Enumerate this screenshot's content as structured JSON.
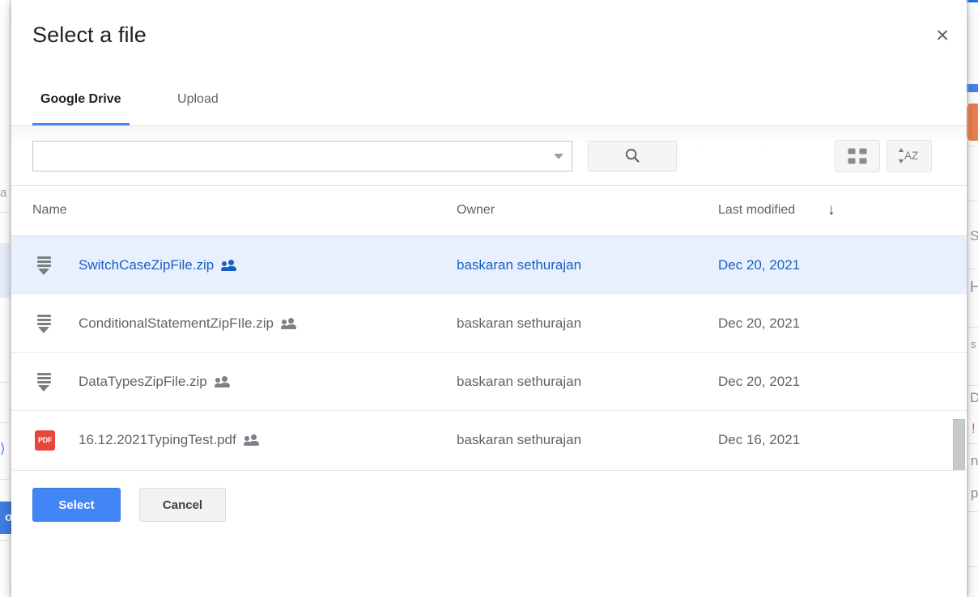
{
  "dialog": {
    "title": "Select a file",
    "close_label": "✕",
    "tabs": [
      {
        "label": "Google Drive",
        "active": true
      },
      {
        "label": "Upload",
        "active": false
      }
    ],
    "toolbar": {
      "search_value": "",
      "search_placeholder": "",
      "search_icon": "search-icon",
      "dropdown_icon": "chevron-down-icon",
      "grid_view_icon": "grid-view-icon",
      "sort_az_icon": "sort-alpha-icon",
      "sort_az_label": "AZ"
    },
    "table": {
      "columns": [
        "Name",
        "Owner",
        "Last modified"
      ],
      "sort_indicator": "↓",
      "sort_column": "Last modified",
      "rows": [
        {
          "icon": "zip-file-icon",
          "name": "SwitchCaseZipFile.zip",
          "shared_icon": "people-shared-icon",
          "owner": "baskaran sethurajan",
          "modified": "Dec 20, 2021",
          "selected": true
        },
        {
          "icon": "zip-file-icon",
          "name": "ConditionalStatementZipFIle.zip",
          "shared_icon": "people-shared-icon",
          "owner": "baskaran sethurajan",
          "modified": "Dec 20, 2021",
          "selected": false
        },
        {
          "icon": "zip-file-icon",
          "name": "DataTypesZipFile.zip",
          "shared_icon": "people-shared-icon",
          "owner": "baskaran sethurajan",
          "modified": "Dec 20, 2021",
          "selected": false
        },
        {
          "icon": "pdf-file-icon",
          "icon_label": "PDF",
          "name": "16.12.2021TypingTest.pdf",
          "shared_icon": "people-shared-icon",
          "owner": "baskaran sethurajan",
          "modified": "Dec 16, 2021",
          "selected": false
        }
      ]
    },
    "footer": {
      "select_label": "Select",
      "cancel_label": "Cancel"
    }
  },
  "background": {
    "left_fragment_a": "a",
    "left_button_fragment": "oc",
    "right_fragment_s1": "S",
    "right_fragment_h": "H",
    "right_fragment_s2": "s",
    "right_fragment_d": "D",
    "right_fragment_excl": "!",
    "right_fragment_n": "n",
    "right_fragment_p": "p",
    "arrow_glyph": "⟩"
  },
  "colors": {
    "accent_blue": "#4285f4",
    "selected_row_bg": "#e8f0fe",
    "link_blue": "#1a5fc4",
    "pdf_red": "#e8453c",
    "text_gray": "#5f6368"
  }
}
